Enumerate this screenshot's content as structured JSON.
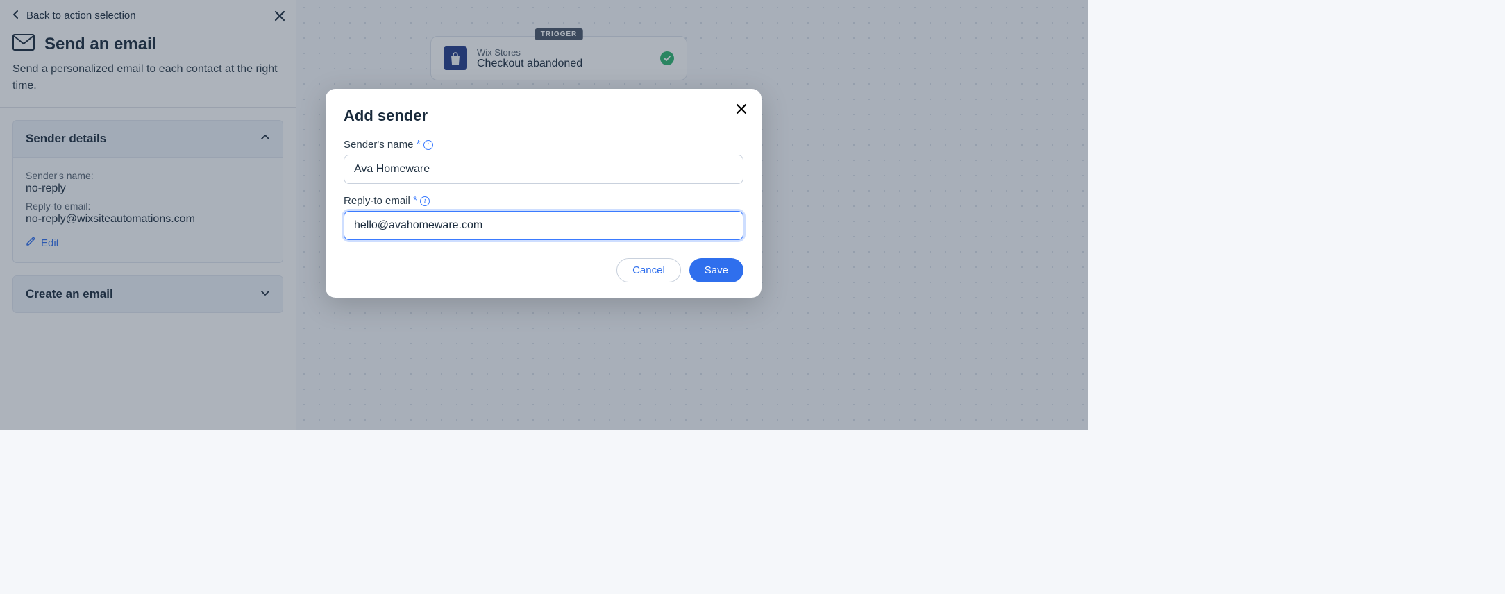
{
  "sidebar": {
    "back_label": "Back to action selection",
    "title": "Send an email",
    "description": "Send a personalized email to each contact at the right time.",
    "panels": {
      "sender_details": {
        "title": "Sender details",
        "name_label": "Sender's name:",
        "name_value": "no-reply",
        "reply_label": "Reply-to email:",
        "reply_value": "no-reply@wixsiteautomations.com",
        "edit_label": "Edit"
      },
      "create_email": {
        "title": "Create an email"
      }
    }
  },
  "canvas": {
    "trigger": {
      "tag": "TRIGGER",
      "app": "Wix Stores",
      "event": "Checkout abandoned"
    }
  },
  "modal": {
    "title": "Add sender",
    "name_label": "Sender's name",
    "name_value": "Ava Homeware",
    "email_label": "Reply-to email",
    "email_value": "hello@avahomeware.com",
    "cancel_label": "Cancel",
    "save_label": "Save"
  }
}
